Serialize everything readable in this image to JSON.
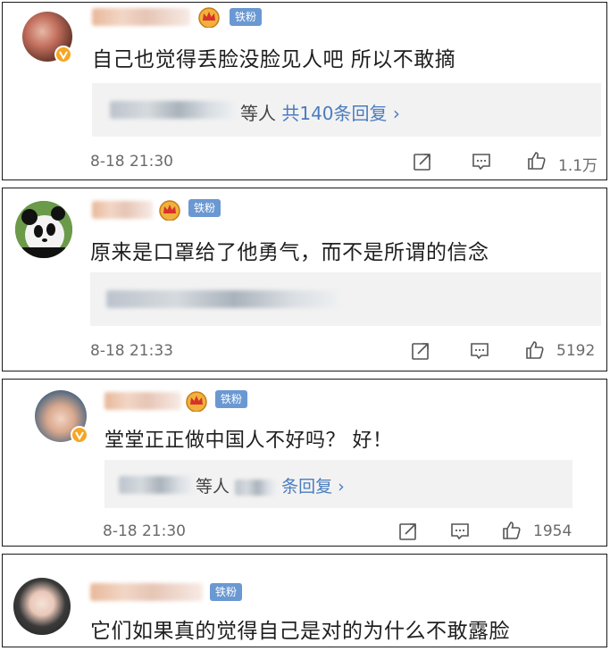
{
  "comments": [
    {
      "badge": "铁粉",
      "text": "自己也觉得丢脸没脸见人吧 所以不敢摘",
      "reply_suffix": "等人",
      "reply_count": "共140条回复 ›",
      "time": "8-18 21:30",
      "likes": "1.1万"
    },
    {
      "badge": "铁粉",
      "text": "原来是口罩给了他勇气，而不是所谓的信念",
      "reply_suffix": "",
      "reply_count": "",
      "time": "8-18 21:33",
      "likes": "5192"
    },
    {
      "badge": "铁粉",
      "text": "堂堂正正做中国人不好吗？ 好！",
      "reply_suffix": "等人",
      "reply_count": "条回复 ›",
      "time": "8-18 21:30",
      "likes": "1954"
    },
    {
      "badge": "铁粉",
      "text": "它们如果真的觉得自己是对的为什么不敢露脸"
    }
  ],
  "icons": [
    "verified-icon",
    "crown-icon",
    "share-icon",
    "comment-icon",
    "like-icon"
  ],
  "colors": {
    "badge": "#6a98d2",
    "reply_link": "#4a7cbf",
    "verified": "#f6a623",
    "reply_bg": "#f2f2f2"
  }
}
